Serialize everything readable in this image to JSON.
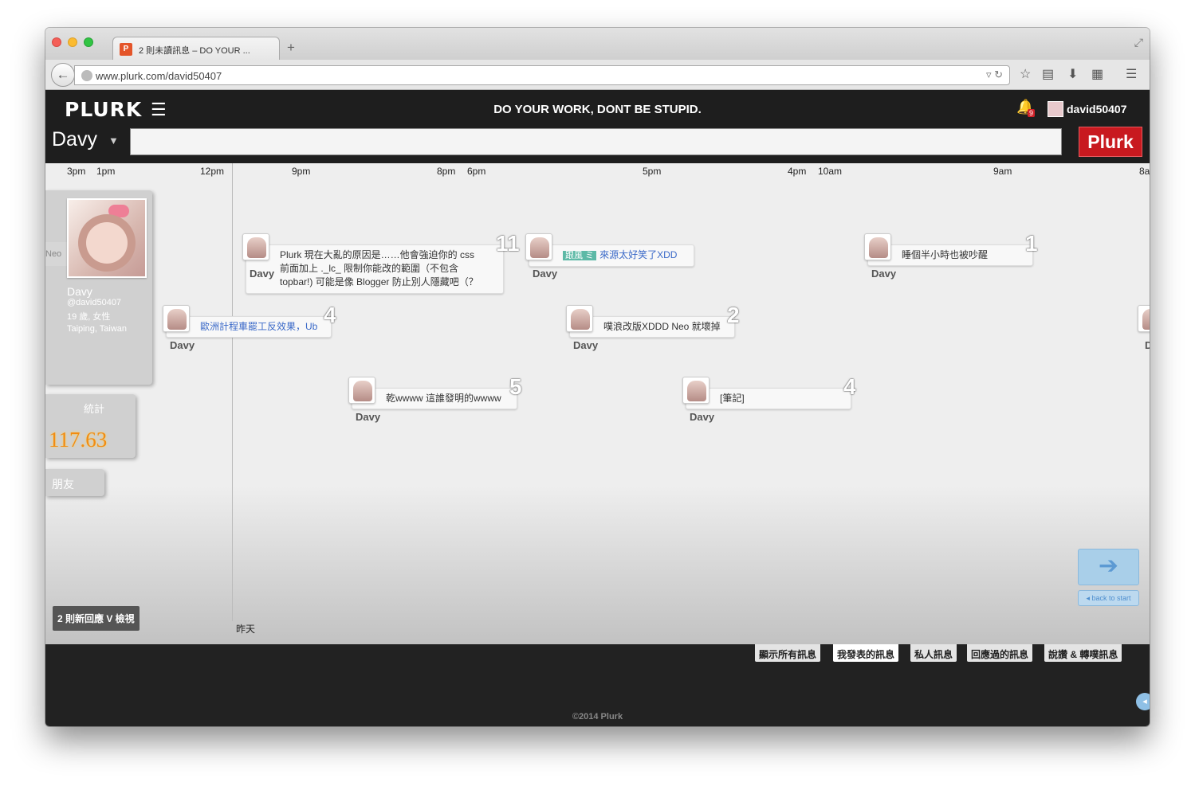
{
  "browser": {
    "tab_title": "2 則未讀訊息 – DO YOUR ...",
    "favicon_letter": "P",
    "new_tab": "+",
    "url": "www.plurk.com/david50407"
  },
  "header": {
    "logo": "PLURK",
    "tagline": "DO YOUR WORK, DONT BE STUPID.",
    "notification_count": "9",
    "username": "david50407"
  },
  "composer": {
    "qualifier": "Davy",
    "button": "Plurk"
  },
  "timeline": {
    "ticks": [
      "3pm",
      "1pm",
      "12pm",
      "9pm",
      "8pm",
      "6pm",
      "5pm",
      "4pm",
      "10am",
      "9am",
      "8a"
    ],
    "day_label": "昨天",
    "plurks": [
      {
        "name": "Davy",
        "lines": [
          "Plurk 現在大亂的原因是……他會強迫你的 css",
          "前面加上 ._lc_ 限制你能改的範圍（不包含",
          "topbar!) 可能是像 Blogger 防止別人隱藏吧（？"
        ],
        "count": "11"
      },
      {
        "name": "Davy",
        "qualifier": "跟風 ミ",
        "text": "來源太好笑了XDD",
        "count": ""
      },
      {
        "name": "Davy",
        "text": "睡個半小時也被吵醒",
        "count": "1"
      },
      {
        "name": "Davy",
        "text": "歐洲計程車罷工反效果，Ub",
        "count": "4"
      },
      {
        "name": "Davy",
        "text": "噗浪改版XDDD Neo 就壞掉",
        "count": "2"
      },
      {
        "name": "Davy",
        "text": "乾wwww 這誰發明的wwww",
        "count": "5"
      },
      {
        "name": "Davy",
        "text": "[筆記]",
        "count": "4"
      },
      {
        "name": "D"
      }
    ]
  },
  "profile": {
    "name": "Davy",
    "nick": "@david50407",
    "info1": "19 歲, 女性",
    "info2": "Taiping, Taiwan",
    "neo": "Neo",
    "stats_label": "統計",
    "karma": "117.63",
    "friends_label": "朋友",
    "new_responses": "2 則新回應 V 檢視"
  },
  "controls": {
    "back_to_start": "back to start"
  },
  "footer": {
    "tabs": [
      "顯示所有訊息",
      "我發表的訊息",
      "私人訊息",
      "回應過的訊息",
      "說讚 & 轉噗訊息"
    ],
    "active_tab": "我發表的訊息",
    "copyright": "©2014 Plurk"
  },
  "colors": {
    "plurk_red": "#c8191f",
    "karma_orange": "#f28c12",
    "topbar_dark": "#1e1e1e"
  },
  "icons": [
    "back-arrow-icon",
    "globe-icon",
    "reload-icon",
    "star-icon",
    "reading-list-icon",
    "download-icon",
    "grid-icon",
    "menu-icon",
    "bell-icon",
    "right-arrow-icon"
  ]
}
